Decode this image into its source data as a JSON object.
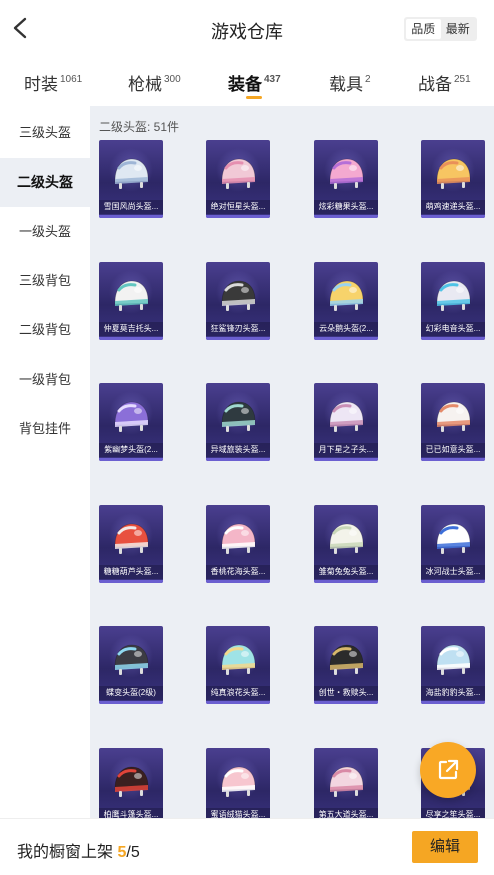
{
  "header": {
    "title": "游戏仓库",
    "sort_options": [
      "品质",
      "最新"
    ],
    "active_sort": "品质"
  },
  "tabs": [
    {
      "label": "时装",
      "count": "1061"
    },
    {
      "label": "枪械",
      "count": "300"
    },
    {
      "label": "装备",
      "count": "437",
      "active": true
    },
    {
      "label": "载具",
      "count": "2"
    },
    {
      "label": "战备",
      "count": "251"
    }
  ],
  "sidebar": {
    "items": [
      "三级头盔",
      "二级头盔",
      "一级头盔",
      "三级背包",
      "二级背包",
      "一级背包",
      "背包挂件"
    ],
    "active_index": 1
  },
  "section": {
    "title": "二级头盔: 51件"
  },
  "items": [
    {
      "name": "雪国风尚头盔...",
      "color": "#dfe8f2",
      "accent": "#9fb6d6"
    },
    {
      "name": "绝对恒星头盔...",
      "color": "#f1c9d6",
      "accent": "#e58fb0"
    },
    {
      "name": "炫彩糖果头盔...",
      "color": "#f4a9d0",
      "accent": "#b56fd8"
    },
    {
      "name": "萌鸡速递头盔...",
      "color": "#f7c562",
      "accent": "#e9905a"
    },
    {
      "name": "仲夏莫吉托头...",
      "color": "#f2f2f2",
      "accent": "#62c6c0"
    },
    {
      "name": "狂鲨锋刃头盔...",
      "color": "#3a3a3a",
      "accent": "#d9d9d9"
    },
    {
      "name": "云朵鹅头盔(2...",
      "color": "#f7d36b",
      "accent": "#9ad3f0"
    },
    {
      "name": "幻彩电音头盔...",
      "color": "#e9e9f2",
      "accent": "#4fc3e6"
    },
    {
      "name": "紫幽梦头盔(2...",
      "color": "#8b6fd8",
      "accent": "#e5dcff"
    },
    {
      "name": "异域旅装头盔...",
      "color": "#2f3a40",
      "accent": "#9fd8d0"
    },
    {
      "name": "月下星之子头...",
      "color": "#ede6f5",
      "accent": "#c98fb6"
    },
    {
      "name": "已已如意头盔...",
      "color": "#f6f2f0",
      "accent": "#e48a6a"
    },
    {
      "name": "糖糖葫芦头盔...",
      "color": "#e8503f",
      "accent": "#f3e9e6"
    },
    {
      "name": "香桃花海头盔...",
      "color": "#f4b6c8",
      "accent": "#ffffff"
    },
    {
      "name": "雏菊兔兔头盔...",
      "color": "#f3f3ea",
      "accent": "#c9d7b9"
    },
    {
      "name": "冰河战士头盔...",
      "color": "#ffffff",
      "accent": "#3d6fd9"
    },
    {
      "name": "蝶变头盔(2级)",
      "color": "#3c3c44",
      "accent": "#8fd8f0"
    },
    {
      "name": "纯真浪花头盔...",
      "color": "#9fe3e6",
      "accent": "#f3d88c"
    },
    {
      "name": "创世・救赎头...",
      "color": "#2b2b2b",
      "accent": "#d8b86b"
    },
    {
      "name": "海盐豹豹头盔...",
      "color": "#bfe0f2",
      "accent": "#ffffff"
    },
    {
      "name": "柏鹰斗篷头盔...",
      "color": "#3a2020",
      "accent": "#e0443a"
    },
    {
      "name": "蜜语绒猫头盔...",
      "color": "#f7c6cf",
      "accent": "#ffffff"
    },
    {
      "name": "第五大道头盔...",
      "color": "#f3d6e0",
      "accent": "#d98aa6"
    },
    {
      "name": "尽享之笙头盔...",
      "color": "#f0e8d8",
      "accent": "#d0a060"
    }
  ],
  "footer": {
    "label": "我的橱窗上架",
    "current": "5",
    "separator": "/",
    "total": "5",
    "edit_label": "编辑"
  },
  "fab": {
    "icon": "share-out-icon"
  },
  "colors": {
    "accent": "#f5a623",
    "content_bg": "#eceff4",
    "card_bg": "#2d2766"
  }
}
